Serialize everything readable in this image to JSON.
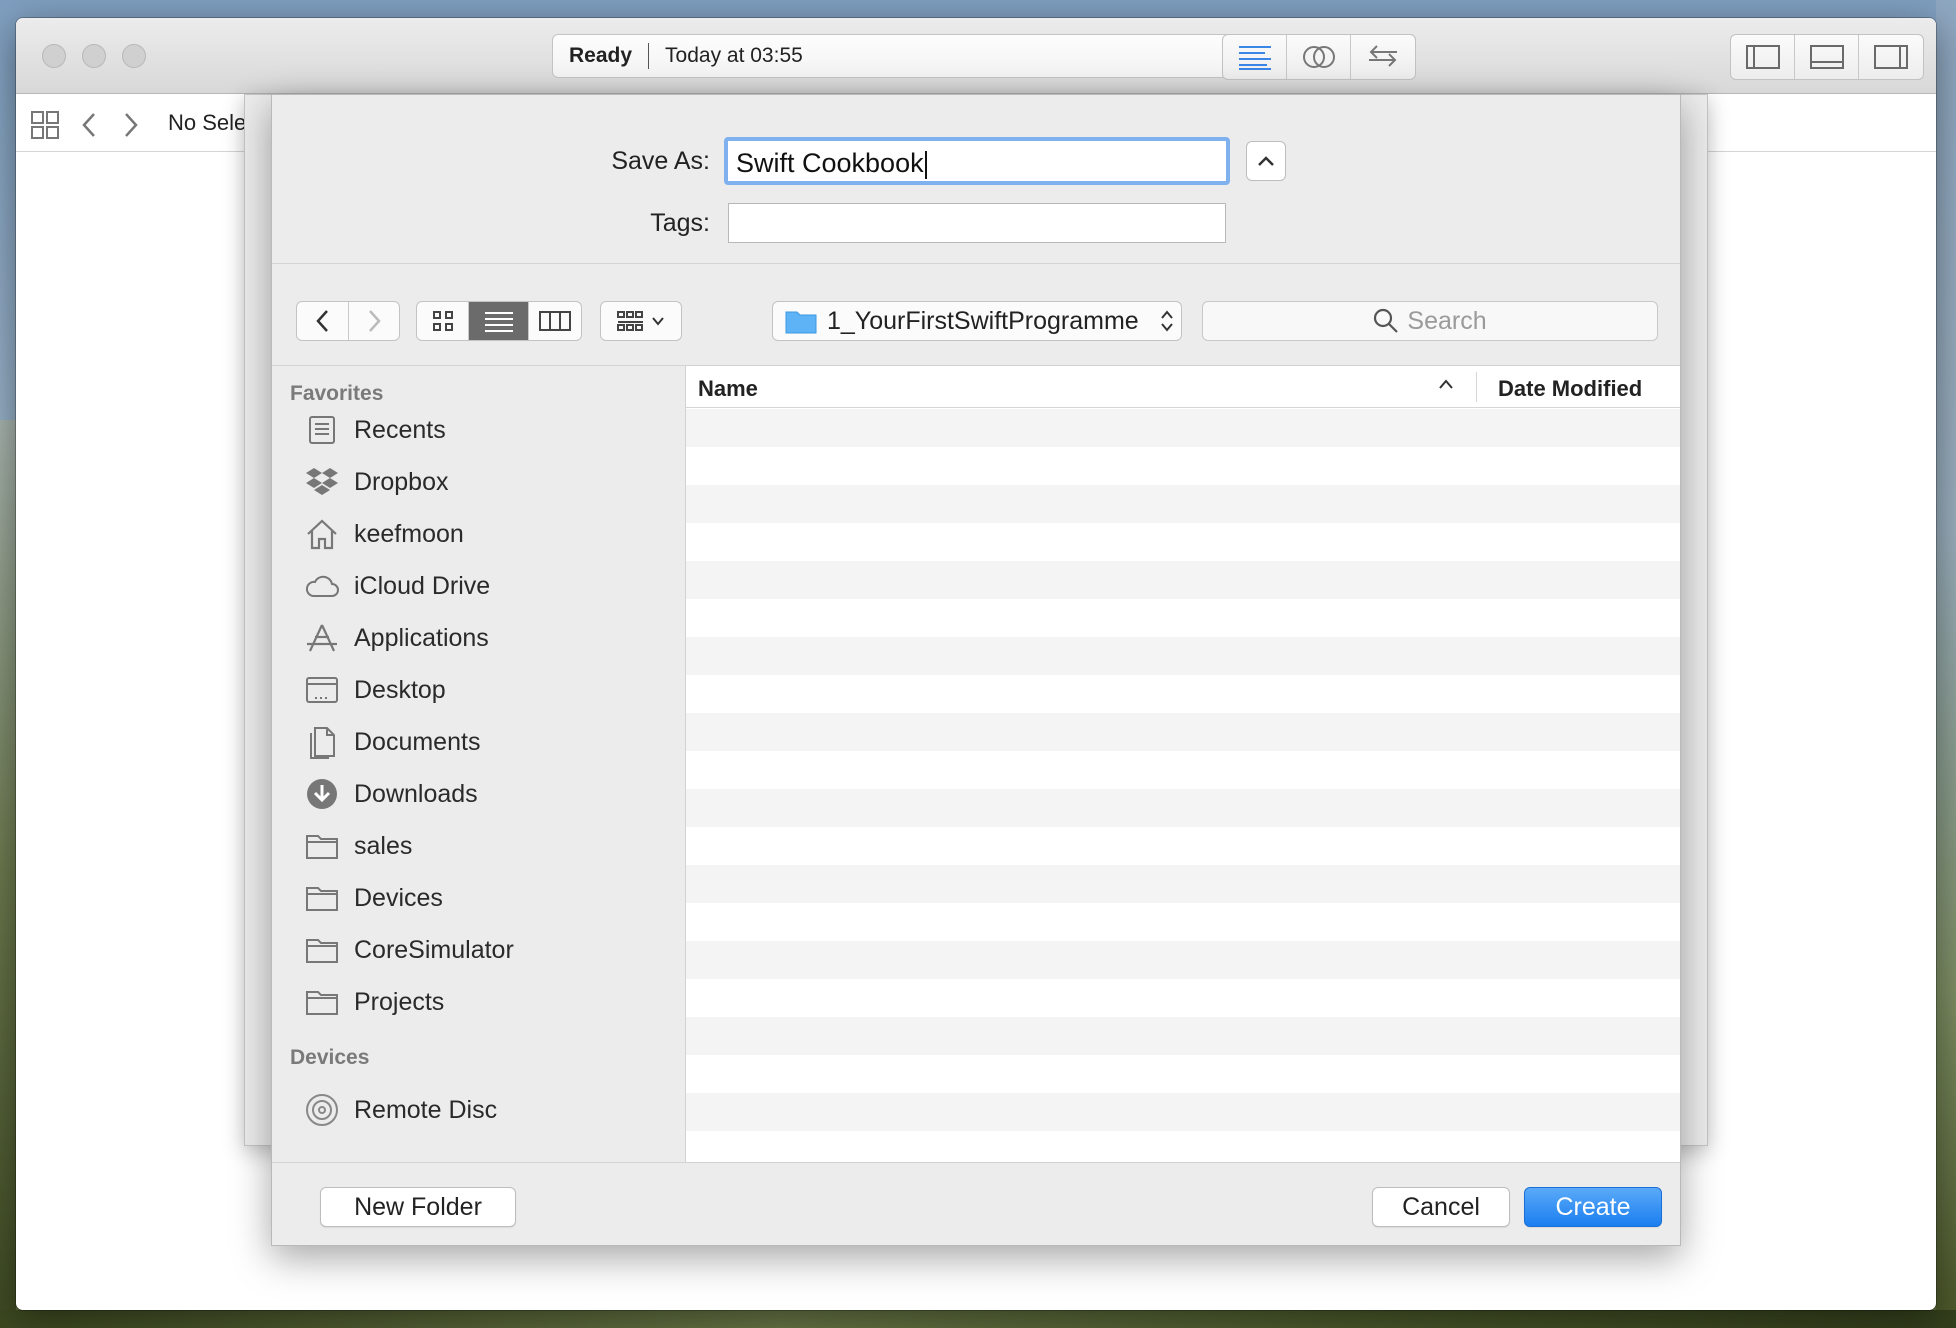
{
  "window": {
    "activity": {
      "status": "Ready",
      "time": "Today at 03:55"
    },
    "jumpbar": {
      "selection": "No Sele"
    }
  },
  "dialog": {
    "save_as_label": "Save As:",
    "save_as_value": "Swift Cookbook",
    "tags_label": "Tags:",
    "tags_value": "",
    "path": "1_YourFirstSwiftProgramme",
    "search_placeholder": "Search",
    "sidebar": {
      "favorites_header": "Favorites",
      "favorites": [
        {
          "label": "Recents",
          "icon": "recents-icon"
        },
        {
          "label": "Dropbox",
          "icon": "dropbox-icon"
        },
        {
          "label": "keefmoon",
          "icon": "home-icon"
        },
        {
          "label": "iCloud Drive",
          "icon": "cloud-icon"
        },
        {
          "label": "Applications",
          "icon": "applications-icon"
        },
        {
          "label": "Desktop",
          "icon": "desktop-icon"
        },
        {
          "label": "Documents",
          "icon": "documents-icon"
        },
        {
          "label": "Downloads",
          "icon": "downloads-icon"
        },
        {
          "label": "sales",
          "icon": "folder-icon"
        },
        {
          "label": "Devices",
          "icon": "folder-icon"
        },
        {
          "label": "CoreSimulator",
          "icon": "folder-icon"
        },
        {
          "label": "Projects",
          "icon": "folder-icon"
        }
      ],
      "devices_header": "Devices",
      "devices": [
        {
          "label": "Remote Disc",
          "icon": "disc-icon"
        }
      ]
    },
    "columns": {
      "name": "Name",
      "date_modified": "Date Modified"
    },
    "buttons": {
      "new_folder": "New Folder",
      "cancel": "Cancel",
      "create": "Create"
    }
  },
  "colors": {
    "accent": "#1b7ef0",
    "focus_ring": "#7eb1ee",
    "folder": "#5db3f5"
  }
}
